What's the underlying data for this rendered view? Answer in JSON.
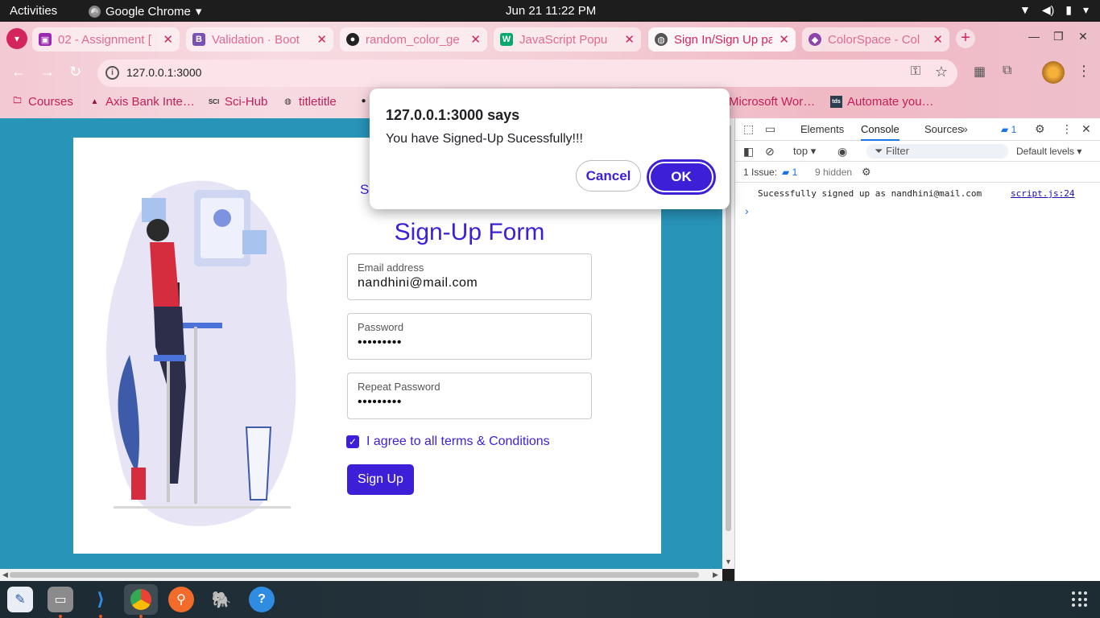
{
  "system": {
    "activities": "Activities",
    "app_name": "Google Chrome",
    "clock": "Jun 21  11:22 PM"
  },
  "tabs": [
    {
      "title": "02 - Assignment [",
      "favicon": "assignment-icon",
      "color": "#9c27b0"
    },
    {
      "title": "Validation · Boot",
      "favicon": "bootstrap-icon",
      "color": "#7952b3"
    },
    {
      "title": "random_color_ge",
      "favicon": "github-icon",
      "color": "#222222"
    },
    {
      "title": "JavaScript Popu",
      "favicon": "w3schools-icon",
      "color": "#04aa6d"
    },
    {
      "title": "Sign In/Sign Up pa",
      "favicon": "globe-icon",
      "color": "#555555"
    },
    {
      "title": "ColorSpace - Col",
      "favicon": "colorspace-icon",
      "color": "#8e44ad"
    }
  ],
  "address_bar": {
    "url": "127.0.0.1:3000"
  },
  "bookmarks": [
    {
      "label": "Courses",
      "icon": "folder-icon"
    },
    {
      "label": "Axis Bank Inte…",
      "icon": "axis-bank-icon"
    },
    {
      "label": "Sci-Hub",
      "icon": "scihub-icon"
    },
    {
      "label": "titletitle",
      "icon": "globe-icon"
    },
    {
      "label": "Microsoft Wor…",
      "icon": "word-icon"
    },
    {
      "label": "Automate you…",
      "icon": "tds-icon"
    }
  ],
  "page": {
    "peek_text": "S",
    "form_title": "Sign-Up Form",
    "email": {
      "label": "Email address",
      "value": "nandhini@mail.com"
    },
    "password": {
      "label": "Password",
      "value": "•••••••••"
    },
    "repeat_password": {
      "label": "Repeat Password",
      "value": "•••••••••"
    },
    "terms": {
      "label": "I agree to all terms & Conditions",
      "checked": true
    },
    "submit_label": "Sign Up",
    "accent_color": "#3c1fd6",
    "background_color": "#2894b8"
  },
  "dialog": {
    "title": "127.0.0.1:3000 says",
    "message": "You have Signed-Up Sucessfully!!!",
    "cancel_label": "Cancel",
    "ok_label": "OK"
  },
  "devtools": {
    "tabs": [
      "Elements",
      "Console",
      "Sources"
    ],
    "active_tab": "Console",
    "issues_badge": "1",
    "context": "top",
    "filter_placeholder": "Filter",
    "levels": "Default levels",
    "issues_label": "1 Issue:",
    "issues_count": "1",
    "hidden_label": "9 hidden",
    "log": {
      "message": "Sucessfully signed up as nandhini@mail.com",
      "source": "script.js:24"
    }
  }
}
